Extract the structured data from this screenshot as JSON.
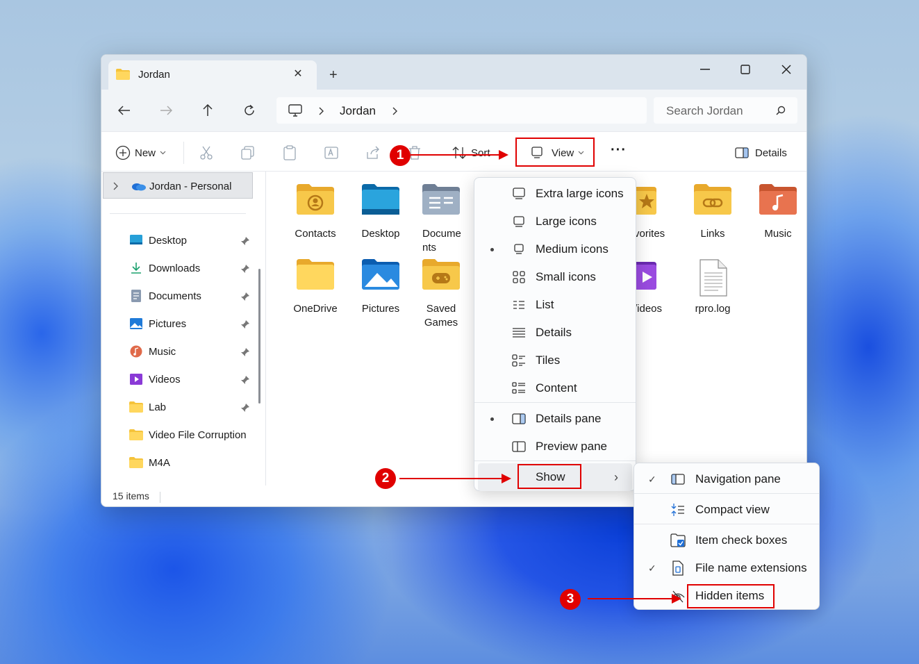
{
  "window": {
    "tab_title": "Jordan",
    "tab_close": "✕",
    "new_tab": "+",
    "controls": {
      "minimize": "—",
      "maximize": "☐",
      "close": "✕"
    }
  },
  "navbar": {
    "breadcrumb": [
      "Jordan"
    ],
    "search_placeholder": "Search Jordan"
  },
  "toolbar": {
    "new_label": "New",
    "sort_label": "Sort",
    "view_label": "View",
    "more_label": "···",
    "details_label": "Details"
  },
  "sidebar": {
    "root_label": "Jordan - Personal",
    "items": [
      {
        "label": "Desktop",
        "icon": "desktop-icon",
        "pinned": true
      },
      {
        "label": "Downloads",
        "icon": "download-icon",
        "pinned": true
      },
      {
        "label": "Documents",
        "icon": "document-icon",
        "pinned": true
      },
      {
        "label": "Pictures",
        "icon": "picture-icon",
        "pinned": true
      },
      {
        "label": "Music",
        "icon": "music-icon",
        "pinned": true
      },
      {
        "label": "Videos",
        "icon": "video-icon",
        "pinned": true
      },
      {
        "label": "Lab",
        "icon": "folder-icon",
        "pinned": true
      },
      {
        "label": "Video File Corruption",
        "icon": "folder-icon",
        "pinned": false
      },
      {
        "label": "M4A",
        "icon": "folder-icon",
        "pinned": false
      }
    ]
  },
  "files": {
    "row1": [
      {
        "label": "Contacts"
      },
      {
        "label": "Desktop"
      },
      {
        "label": "Docume\nnts"
      },
      {
        "label": "vorites"
      },
      {
        "label": "Links"
      },
      {
        "label": "Music"
      }
    ],
    "row2": [
      {
        "label": "OneDrive"
      },
      {
        "label": "Pictures"
      },
      {
        "label": "Saved\nGames"
      },
      {
        "label": "/ideos"
      },
      {
        "label": "rpro.log"
      }
    ]
  },
  "status": {
    "count": "15 items"
  },
  "view_menu": {
    "items": [
      {
        "label": "Extra large icons",
        "selected": false
      },
      {
        "label": "Large icons",
        "selected": false
      },
      {
        "label": "Medium icons",
        "selected": true
      },
      {
        "label": "Small icons",
        "selected": false
      },
      {
        "label": "List",
        "selected": false
      },
      {
        "label": "Details",
        "selected": false
      },
      {
        "label": "Tiles",
        "selected": false
      },
      {
        "label": "Content",
        "selected": false
      }
    ],
    "panes": [
      {
        "label": "Details pane",
        "selected": true
      },
      {
        "label": "Preview pane",
        "selected": false
      }
    ],
    "show_label": "Show",
    "show_chevron": "›"
  },
  "show_menu": {
    "items": [
      {
        "label": "Navigation pane",
        "checked": true
      },
      {
        "label": "Compact view",
        "checked": false
      },
      {
        "label": "Item check boxes",
        "checked": false
      },
      {
        "label": "File name extensions",
        "checked": true
      },
      {
        "label": "Hidden items",
        "checked": false
      }
    ],
    "check": "✓"
  },
  "annotations": {
    "step1": "1",
    "step2": "2",
    "step3": "3"
  },
  "colors": {
    "annotation_red": "#e00000",
    "folder_yellow": "#f5c33b",
    "accent_blue": "#1f6fd6"
  }
}
